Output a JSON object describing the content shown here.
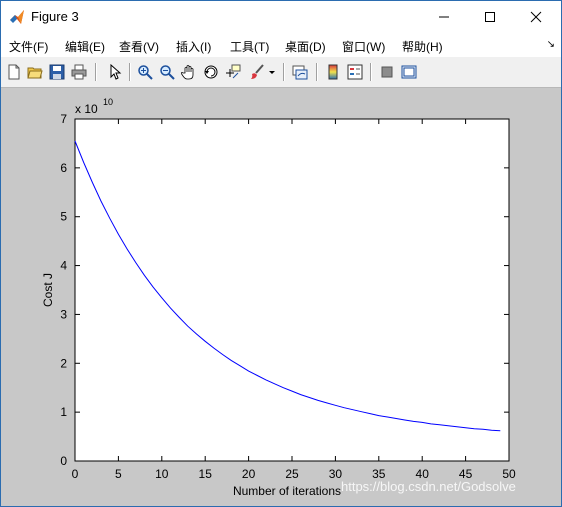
{
  "window": {
    "title": "Figure 3",
    "controls": {
      "minimize": "minimize-icon",
      "maximize": "maximize-icon",
      "close": "close-icon"
    }
  },
  "menu": {
    "items": [
      "文件(F)",
      "编辑(E)",
      "查看(V)",
      "插入(I)",
      "工具(T)",
      "桌面(D)",
      "窗口(W)",
      "帮助(H)"
    ]
  },
  "toolbar": {
    "icons": [
      "new-figure-icon",
      "open-file-icon",
      "save-icon",
      "print-icon",
      "pointer-icon",
      "zoom-in-icon",
      "zoom-out-icon",
      "pan-icon",
      "rotate-3d-icon",
      "data-cursor-icon",
      "brush-icon",
      "brush-dropdown-icon",
      "link-plot-icon",
      "colorbar-icon",
      "legend-icon",
      "hide-plot-tools-icon",
      "show-plot-tools-icon"
    ]
  },
  "watermark": "https://blog.csdn.net/Godsolve",
  "chart_data": {
    "type": "line",
    "title": "",
    "xlabel": "Number of iterations",
    "ylabel": "Cost J",
    "exponent_label": "x 10",
    "exponent_power": "10",
    "xlim": [
      0,
      50
    ],
    "ylim": [
      0,
      7
    ],
    "xticks": [
      0,
      5,
      10,
      15,
      20,
      25,
      30,
      35,
      40,
      45,
      50
    ],
    "yticks": [
      0,
      1,
      2,
      3,
      4,
      5,
      6,
      7
    ],
    "grid": false,
    "series": [
      {
        "color": "#0000ff",
        "x": [
          0,
          1,
          2,
          3,
          4,
          5,
          6,
          7,
          8,
          9,
          10,
          11,
          12,
          13,
          14,
          15,
          16,
          17,
          18,
          19,
          20,
          21,
          22,
          23,
          24,
          25,
          26,
          27,
          28,
          29,
          30,
          31,
          32,
          33,
          34,
          35,
          36,
          37,
          38,
          39,
          40,
          41,
          42,
          43,
          44,
          45,
          46,
          47,
          48,
          49
        ],
        "y": [
          6.55,
          6.11,
          5.7,
          5.32,
          4.97,
          4.64,
          4.34,
          4.06,
          3.8,
          3.56,
          3.34,
          3.13,
          2.94,
          2.76,
          2.6,
          2.45,
          2.31,
          2.18,
          2.06,
          1.95,
          1.84,
          1.75,
          1.66,
          1.58,
          1.5,
          1.43,
          1.36,
          1.3,
          1.24,
          1.19,
          1.14,
          1.09,
          1.05,
          1.01,
          0.97,
          0.93,
          0.9,
          0.87,
          0.84,
          0.81,
          0.79,
          0.76,
          0.74,
          0.72,
          0.7,
          0.68,
          0.66,
          0.65,
          0.63,
          0.62
        ]
      }
    ]
  }
}
